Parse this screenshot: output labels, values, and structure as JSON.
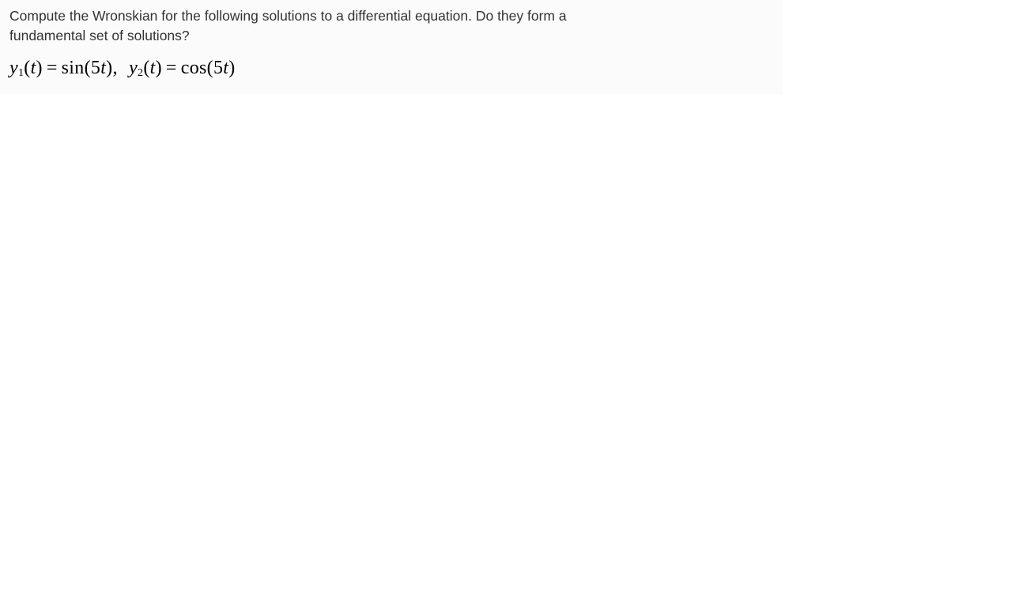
{
  "question": {
    "prompt_line1": "Compute the Wronskian for the following solutions to a differential equation.  Do they form a",
    "prompt_line2": "fundamental set of solutions?"
  },
  "equation": {
    "y1_label": "y",
    "y1_sub": "1",
    "y1_arg_open": "(",
    "y1_arg": "t",
    "y1_arg_close": ")",
    "eq1": "=",
    "y1_func": "sin",
    "y1_inner_open": "(",
    "y1_inner_coef": "5",
    "y1_inner_var": "t",
    "y1_inner_close": ")",
    "separator": ",",
    "y2_label": "y",
    "y2_sub": "2",
    "y2_arg_open": "(",
    "y2_arg": "t",
    "y2_arg_close": ")",
    "eq2": "=",
    "y2_func": "cos",
    "y2_inner_open": "(",
    "y2_inner_coef": "5",
    "y2_inner_var": "t",
    "y2_inner_close": ")"
  }
}
